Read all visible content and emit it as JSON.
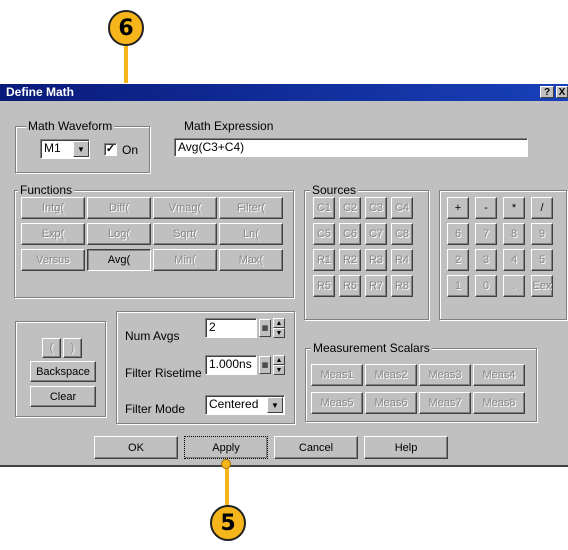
{
  "callouts": {
    "top": "6",
    "bottom": "5"
  },
  "dialog": {
    "title": "Define Math",
    "help_btn": "?",
    "close_btn": "X"
  },
  "math_waveform": {
    "label": "Math Waveform",
    "selected": "M1",
    "on_label": "On",
    "on_checked": true
  },
  "math_expression": {
    "label": "Math Expression",
    "value": "Avg(C3+C4)"
  },
  "functions": {
    "label": "Functions",
    "buttons": [
      "Intg(",
      "Diff(",
      "Vmag(",
      "Filter(",
      "Exp(",
      "Log(",
      "Sqrt(",
      "Ln(",
      "Versus",
      "Avg(",
      "Min(",
      "Max("
    ]
  },
  "sources": {
    "label": "Sources",
    "buttons": [
      "C1",
      "C2",
      "C3",
      "C4",
      "C5",
      "C6",
      "C7",
      "C8",
      "R1",
      "R2",
      "R3",
      "R4",
      "R5",
      "R6",
      "R7",
      "R8"
    ]
  },
  "keypad": {
    "buttons": [
      "+",
      "-",
      "*",
      "/",
      "6",
      "7",
      "8",
      "9",
      "2",
      "3",
      "4",
      "5",
      "1",
      "0",
      ".",
      "Eex"
    ]
  },
  "edit": {
    "paren_open": "(",
    "paren_close": ")",
    "backspace": "Backspace",
    "clear": "Clear"
  },
  "settings": {
    "num_avgs_label": "Num Avgs",
    "num_avgs_value": "2",
    "filter_risetime_label": "Filter Risetime",
    "filter_risetime_value": "1.000ns",
    "filter_mode_label": "Filter Mode",
    "filter_mode_value": "Centered"
  },
  "measurement_scalars": {
    "label": "Measurement Scalars",
    "buttons": [
      "Meas1",
      "Meas2",
      "Meas3",
      "Meas4",
      "Meas5",
      "Meas6",
      "Meas7",
      "Meas8"
    ]
  },
  "footer": {
    "ok": "OK",
    "apply": "Apply",
    "cancel": "Cancel",
    "help": "Help"
  }
}
